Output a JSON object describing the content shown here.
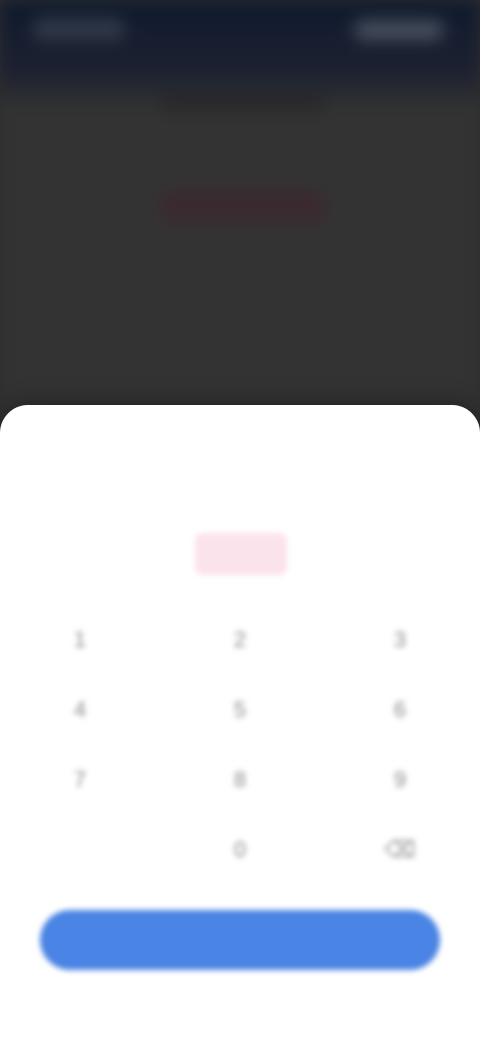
{
  "background_app": {
    "back_label": "",
    "title": "",
    "value": ""
  },
  "sheet": {
    "title": "",
    "amount": "",
    "keypad": {
      "keys": [
        "1",
        "2",
        "3",
        "4",
        "5",
        "6",
        "7",
        "8",
        "9",
        "",
        "0",
        "⌫"
      ]
    },
    "confirm_label": ""
  },
  "colors": {
    "accent": "#4a84e4",
    "amount_text": "#e05a8a",
    "amount_bg": "#fbe3ec",
    "backdrop": "#333333",
    "topbar": "#0f1a2e"
  }
}
